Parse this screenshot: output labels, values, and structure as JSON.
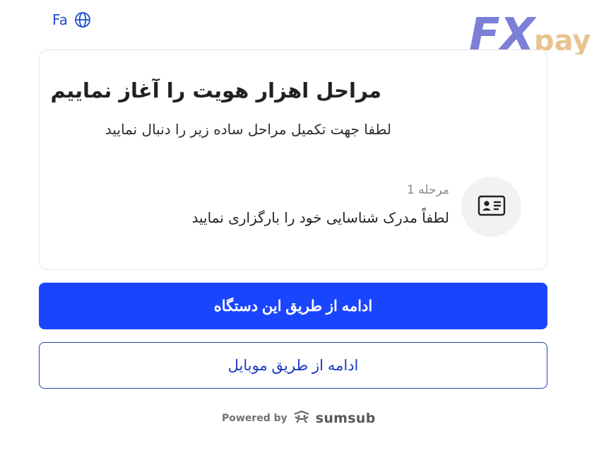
{
  "language": {
    "label": "Fa",
    "icon": "globe-icon"
  },
  "logo": {
    "text_primary": "FX",
    "text_secondary": "pay",
    "color_primary": "#7b7fd6",
    "color_secondary": "#e8c38e"
  },
  "card": {
    "title": "مراحل اهزار هویت را آغاز نماییم",
    "subtitle": "لطفا جهت تکمیل مراحل ساده زیر را دنبال نمایید",
    "step": {
      "label": "مرحله 1",
      "text": "لطفاً مدرک شناسایی خود را بارگزاری نمایید",
      "icon": "id-card-icon"
    }
  },
  "actions": {
    "primary_label": "ادامه از طریق این دستگاه",
    "secondary_label": "ادامه از طریق موبایل"
  },
  "footer": {
    "powered_by": "Powered by",
    "brand": "sumsub",
    "brand_icon": "sumsub-logo-icon"
  },
  "colors": {
    "accent": "#1a45ff",
    "link": "#1f4fd1"
  }
}
